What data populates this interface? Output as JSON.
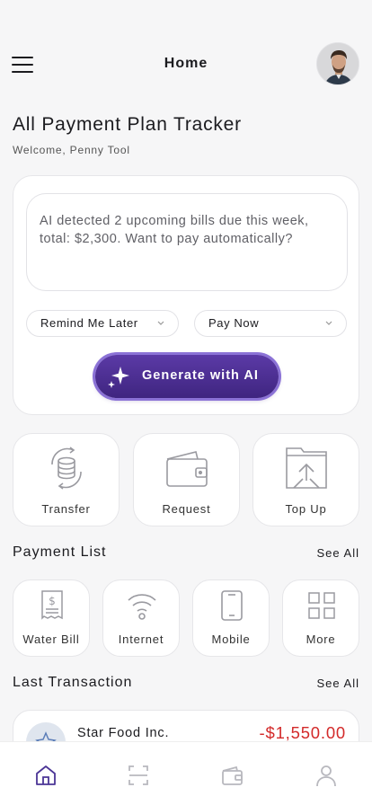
{
  "header": {
    "title": "Home"
  },
  "page": {
    "title": "All Payment Plan Tracker",
    "welcome": "Welcome, Penny Tool"
  },
  "ai_card": {
    "message": "AI detected 2 upcoming bills due this week, total: $2,300. Want to pay automatically?",
    "select_1": "Remind Me Later",
    "select_2": "Pay Now",
    "generate_label": "Generate with AI"
  },
  "actions": [
    {
      "label": "Transfer",
      "icon": "transfer-icon"
    },
    {
      "label": "Request",
      "icon": "wallet-icon"
    },
    {
      "label": "Top Up",
      "icon": "top-up-icon"
    }
  ],
  "payment_list": {
    "title": "Payment List",
    "see_all": "See All",
    "items": [
      {
        "label": "Water Bill",
        "icon": "bill-icon"
      },
      {
        "label": "Internet",
        "icon": "wifi-icon"
      },
      {
        "label": "Mobile",
        "icon": "mobile-icon"
      },
      {
        "label": "More",
        "icon": "grid-icon"
      }
    ]
  },
  "last_transaction": {
    "title": "Last Transaction",
    "see_all": "See All",
    "items": [
      {
        "name": "Star Food Inc.",
        "amount": "-$1,550.00"
      }
    ]
  },
  "tabbar": {
    "tabs": [
      "home-icon",
      "scan-icon",
      "wallet-icon",
      "profile-icon"
    ],
    "active_color": "#4b3596",
    "inactive_color": "#b8b8be"
  },
  "colors": {
    "accent": "#4b2f91",
    "negative": "#d32a2a"
  }
}
